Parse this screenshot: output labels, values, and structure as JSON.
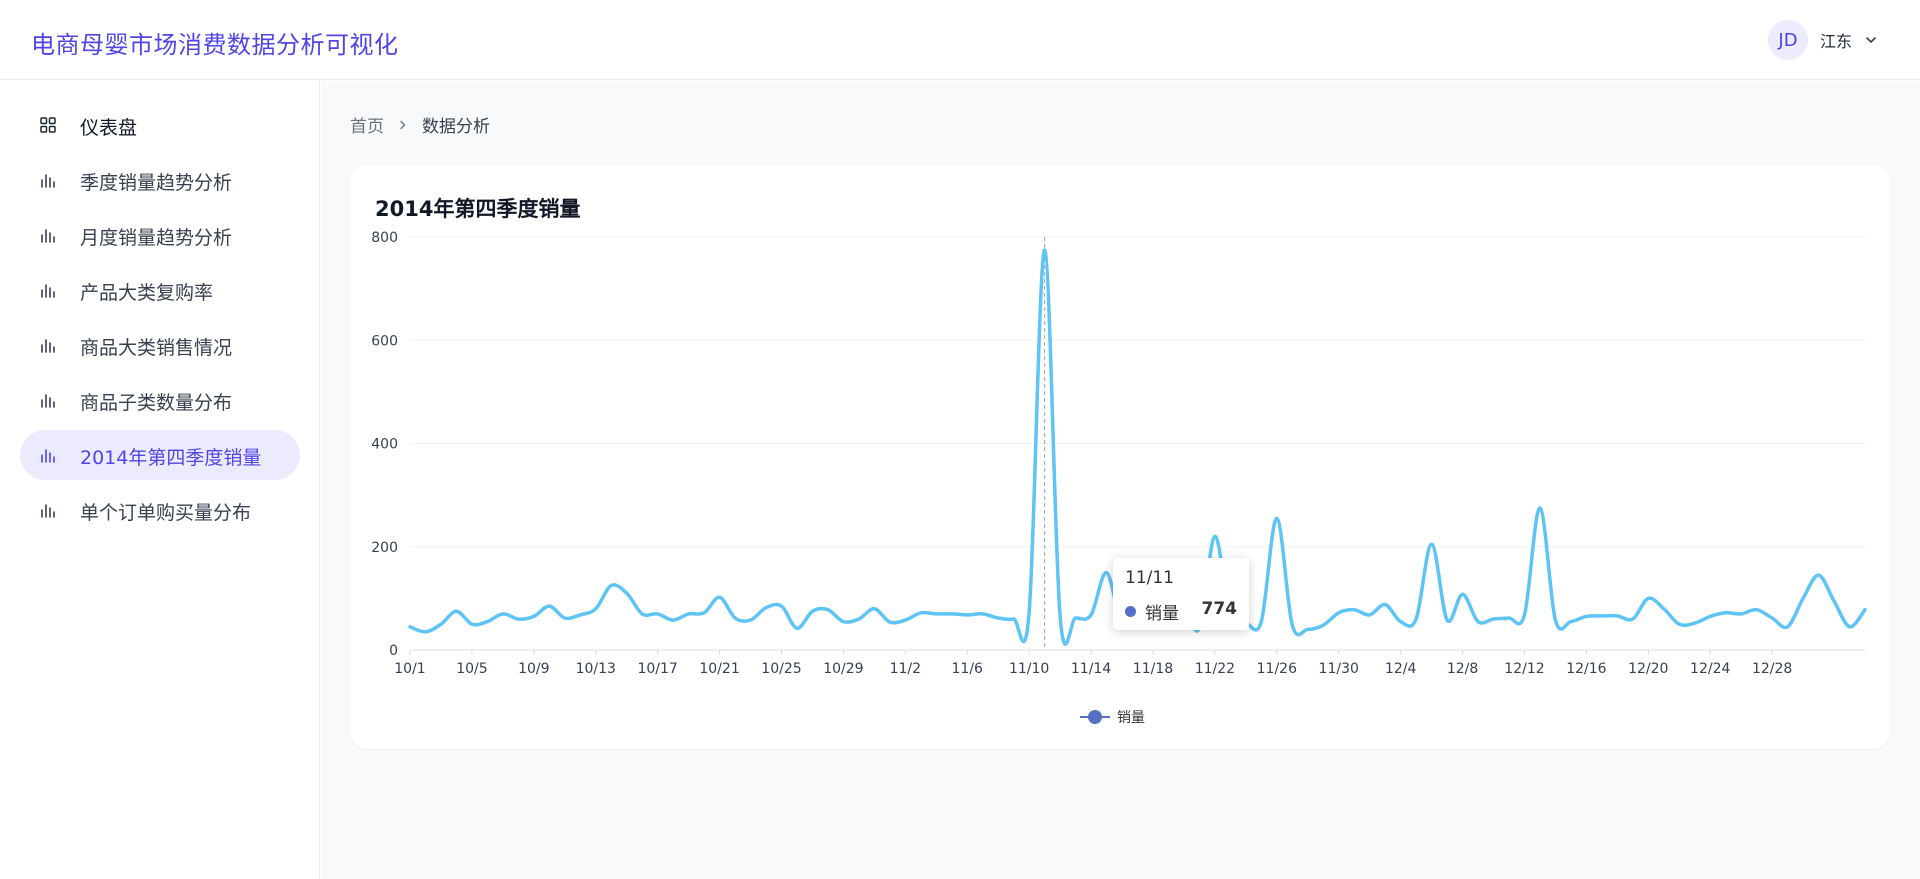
{
  "header": {
    "app_title": "电商母婴市场消费数据分析可视化",
    "user_initials": "JD",
    "user_name": "江东",
    "dropdown_icon": "chevron-down-icon"
  },
  "sidebar": {
    "items": [
      {
        "label": "仪表盘",
        "icon": "dashboard-grid-icon",
        "active": false
      },
      {
        "label": "季度销量趋势分析",
        "icon": "bar-chart-icon",
        "active": false
      },
      {
        "label": "月度销量趋势分析",
        "icon": "bar-chart-icon",
        "active": false
      },
      {
        "label": "产品大类复购率",
        "icon": "bar-chart-icon",
        "active": false
      },
      {
        "label": "商品大类销售情况",
        "icon": "bar-chart-icon",
        "active": false
      },
      {
        "label": "商品子类数量分布",
        "icon": "bar-chart-icon",
        "active": false
      },
      {
        "label": "2014年第四季度销量",
        "icon": "bar-chart-icon",
        "active": true
      },
      {
        "label": "单个订单购买量分布",
        "icon": "bar-chart-icon",
        "active": false
      }
    ]
  },
  "breadcrumb": {
    "home": "首页",
    "current": "数据分析"
  },
  "colors": {
    "accent": "#4f46e5",
    "active_bg": "#ecebfd",
    "line": "#5ec4f5",
    "legend_marker": "#5470c6"
  },
  "card": {
    "title": "2014年第四季度销量"
  },
  "tooltip": {
    "title": "11/11",
    "series_name": "销量",
    "value": "774"
  },
  "chart_data": {
    "type": "line",
    "title": "2014年第四季度销量",
    "xlabel": "",
    "ylabel": "",
    "ylim": [
      0,
      800
    ],
    "y_ticks": [
      0,
      200,
      400,
      600,
      800
    ],
    "x_tick_labels": [
      "10/1",
      "10/5",
      "10/9",
      "10/13",
      "10/17",
      "10/21",
      "10/25",
      "10/29",
      "11/2",
      "11/6",
      "11/10",
      "11/14",
      "11/18",
      "11/22",
      "11/26",
      "11/30",
      "12/4",
      "12/8",
      "12/12",
      "12/16",
      "12/20",
      "12/24",
      "12/28"
    ],
    "grid": true,
    "legend_position": "bottom-center",
    "smooth": true,
    "series": [
      {
        "name": "销量",
        "x_start": "10/1",
        "x_end": "12/31",
        "values": [
          45,
          35,
          50,
          75,
          50,
          55,
          70,
          60,
          65,
          85,
          62,
          68,
          80,
          125,
          110,
          70,
          70,
          58,
          70,
          72,
          102,
          62,
          58,
          82,
          85,
          42,
          75,
          78,
          55,
          60,
          80,
          54,
          58,
          72,
          70,
          70,
          68,
          70,
          62,
          60,
          72,
          774,
          65,
          62,
          68,
          150,
          50,
          85,
          74,
          90,
          85,
          42,
          220,
          60,
          52,
          55,
          255,
          48,
          40,
          48,
          72,
          78,
          68,
          88,
          55,
          60,
          205,
          58,
          108,
          55,
          60,
          62,
          68,
          275,
          58,
          55,
          65,
          66,
          66,
          60,
          100,
          80,
          50,
          52,
          65,
          72,
          70,
          78,
          62,
          45,
          100,
          145,
          95,
          45,
          78
        ]
      }
    ]
  }
}
